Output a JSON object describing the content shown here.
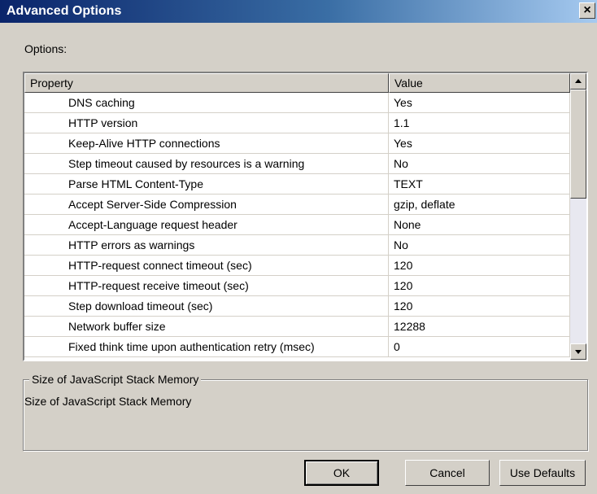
{
  "window": {
    "title": "Advanced Options",
    "close_glyph": "×",
    "close_icon": "close-icon"
  },
  "options_label": "Options:",
  "grid": {
    "columns": [
      "Property",
      "Value"
    ],
    "rows": [
      {
        "property": "DNS caching",
        "value": "Yes"
      },
      {
        "property": "HTTP version",
        "value": "1.1"
      },
      {
        "property": "Keep-Alive HTTP connections",
        "value": "Yes"
      },
      {
        "property": "Step timeout caused by resources is a warning",
        "value": "No"
      },
      {
        "property": "Parse HTML Content-Type",
        "value": "TEXT"
      },
      {
        "property": "Accept Server-Side Compression",
        "value": "gzip, deflate"
      },
      {
        "property": "Accept-Language request header",
        "value": "None"
      },
      {
        "property": "HTTP errors as warnings",
        "value": "No"
      },
      {
        "property": "HTTP-request connect timeout (sec)",
        "value": "120"
      },
      {
        "property": "HTTP-request receive timeout (sec)",
        "value": "120"
      },
      {
        "property": "Step download timeout (sec)",
        "value": "120"
      },
      {
        "property": "Network buffer size",
        "value": "12288"
      },
      {
        "property": "Fixed think time upon authentication retry (msec)",
        "value": "0"
      }
    ],
    "scroll_up_icon": "scroll-up-arrow-icon",
    "scroll_down_icon": "scroll-down-arrow-icon"
  },
  "description": {
    "group_title": "Size of JavaScript Stack Memory",
    "text": "Size of JavaScript Stack Memory"
  },
  "buttons": {
    "ok": "OK",
    "cancel": "Cancel",
    "use_defaults": "Use Defaults"
  }
}
